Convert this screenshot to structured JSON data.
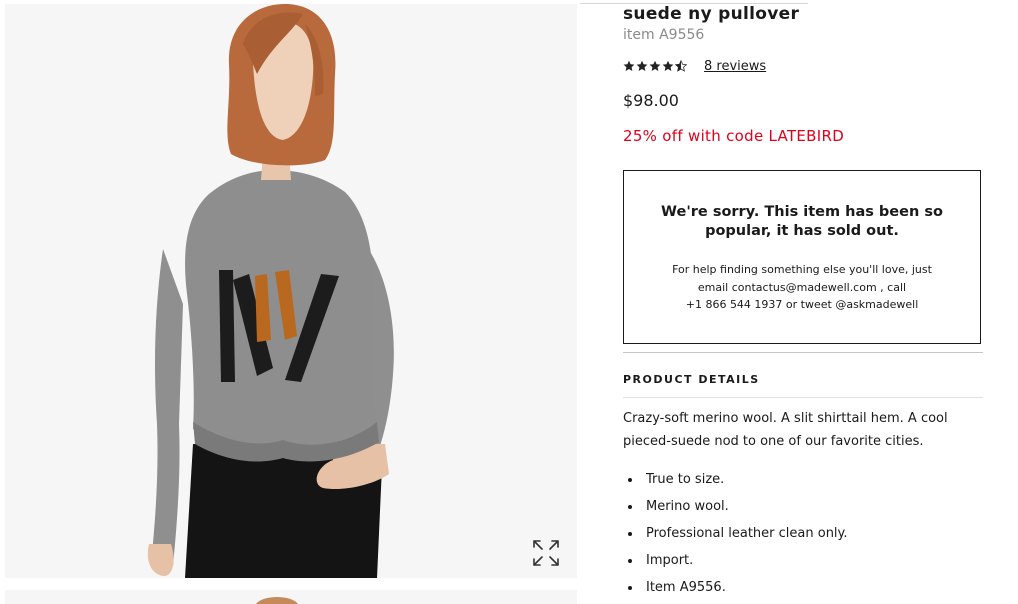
{
  "product": {
    "title": "suede ny pullover",
    "item_number": "item A9556",
    "rating": 4.5,
    "rating_max": 5,
    "reviews_link": "8 reviews",
    "price": "$98.00",
    "promo": "25% off with code LATEBIRD"
  },
  "sold_out": {
    "heading": "We're sorry. This item has been so popular, it has sold out.",
    "help_line1": "For help finding something else you'll love, just",
    "help_line2": "email contactus@madewell.com , call",
    "help_line3": "+1 866 544 1937 or tweet @askmadewell"
  },
  "details": {
    "heading": "PRODUCT DETAILS",
    "description": "Crazy-soft merino wool. A slit shirttail hem. A cool pieced-suede nod to one of our favorite cities.",
    "bullets": [
      "True to size.",
      "Merino wool.",
      "Professional leather clean only.",
      "Import.",
      "Item A9556."
    ]
  },
  "icons": {
    "expand": "expand-arrows-icon",
    "star_full": "star-filled-icon",
    "star_half": "star-half-icon"
  },
  "colors": {
    "promo": "#e0001b",
    "sweater": "#8e8e8e",
    "suede_black": "#1c1c1c",
    "suede_tan": "#b8691f",
    "hair": "#b86a3c"
  }
}
